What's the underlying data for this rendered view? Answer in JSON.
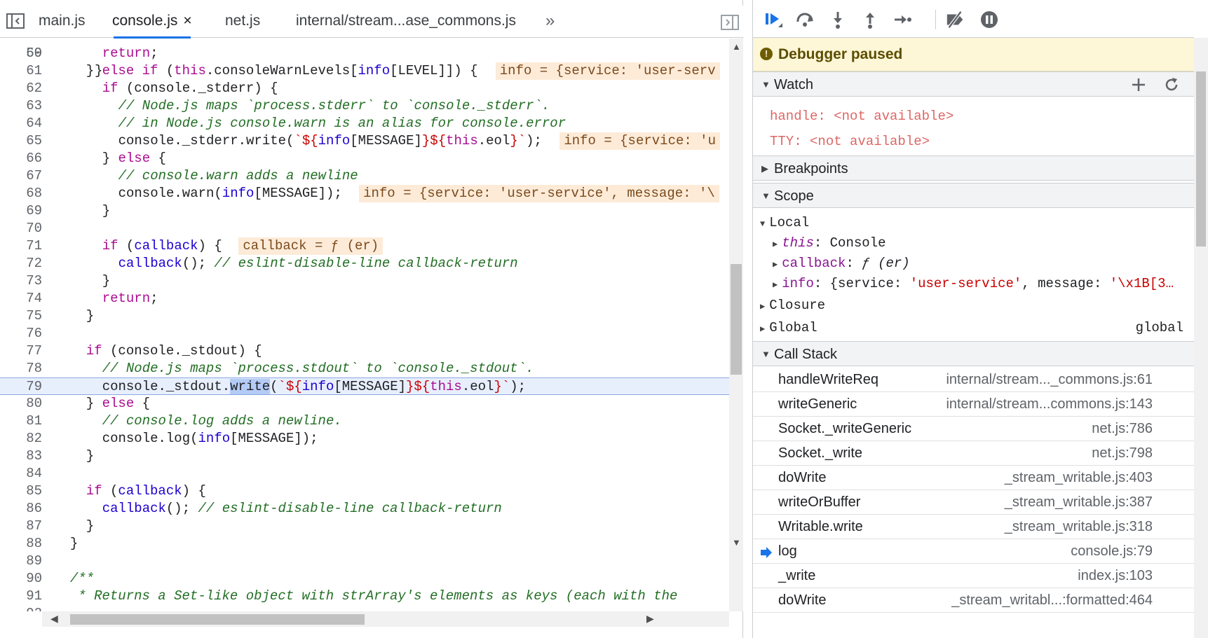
{
  "tabs": [
    {
      "label": "main.js",
      "active": false
    },
    {
      "label": "console.js",
      "active": true
    },
    {
      "label": "net.js",
      "active": false
    },
    {
      "label": "internal/stream...ase_commons.js",
      "active": false
    }
  ],
  "tab_close_glyph": "×",
  "tab_more_glyph": "»",
  "code": {
    "first_line_partial": "59",
    "current_line": "79",
    "lines": [
      {
        "n": "60",
        "indent": 6,
        "parts": [
          [
            "kw",
            "return"
          ],
          [
            "plain",
            ";"
          ]
        ]
      },
      {
        "n": "61",
        "indent": 4,
        "parts": [
          [
            "plain",
            "} "
          ],
          [
            "kw",
            "else if"
          ],
          [
            "plain",
            " ("
          ],
          [
            "kw",
            "this"
          ],
          [
            "plain",
            ".consoleWarnLevels["
          ],
          [
            "id",
            "info"
          ],
          [
            "plain",
            "[LEVEL]]) {"
          ]
        ],
        "inline": "info = {service: 'user-serv"
      },
      {
        "n": "62",
        "indent": 6,
        "parts": [
          [
            "kw",
            "if"
          ],
          [
            "plain",
            " (console._stderr) {"
          ]
        ]
      },
      {
        "n": "63",
        "indent": 8,
        "parts": [
          [
            "cm",
            "// Node.js maps `process.stderr` to `console._stderr`."
          ]
        ]
      },
      {
        "n": "64",
        "indent": 8,
        "parts": [
          [
            "cm",
            "// in Node.js console.warn is an alias for console.error"
          ]
        ]
      },
      {
        "n": "65",
        "indent": 8,
        "parts": [
          [
            "plain",
            "console._stderr.write("
          ],
          [
            "str",
            "`${"
          ],
          [
            "id",
            "info"
          ],
          [
            "plain",
            "[MESSAGE]"
          ],
          [
            "str",
            "}${"
          ],
          [
            "kw",
            "this"
          ],
          [
            "plain",
            ".eol"
          ],
          [
            "str",
            "}`"
          ],
          [
            "plain",
            ");"
          ]
        ],
        "inline": "info = {service: 'u"
      },
      {
        "n": "66",
        "indent": 6,
        "parts": [
          [
            "plain",
            "} "
          ],
          [
            "kw",
            "else"
          ],
          [
            "plain",
            " {"
          ]
        ]
      },
      {
        "n": "67",
        "indent": 8,
        "parts": [
          [
            "cm",
            "// console.warn adds a newline"
          ]
        ]
      },
      {
        "n": "68",
        "indent": 8,
        "parts": [
          [
            "plain",
            "console.warn("
          ],
          [
            "id",
            "info"
          ],
          [
            "plain",
            "[MESSAGE]);"
          ]
        ],
        "inline": "info = {service: 'user-service', message: '\\"
      },
      {
        "n": "69",
        "indent": 6,
        "parts": [
          [
            "plain",
            "}"
          ]
        ]
      },
      {
        "n": "70",
        "indent": 0,
        "parts": []
      },
      {
        "n": "71",
        "indent": 6,
        "parts": [
          [
            "kw",
            "if"
          ],
          [
            "plain",
            " ("
          ],
          [
            "id",
            "callback"
          ],
          [
            "plain",
            ") {"
          ]
        ],
        "inline": "callback = ƒ (er)"
      },
      {
        "n": "72",
        "indent": 8,
        "parts": [
          [
            "id",
            "callback"
          ],
          [
            "plain",
            "(); "
          ],
          [
            "cm",
            "// eslint-disable-line callback-return"
          ]
        ]
      },
      {
        "n": "73",
        "indent": 6,
        "parts": [
          [
            "plain",
            "}"
          ]
        ]
      },
      {
        "n": "74",
        "indent": 6,
        "parts": [
          [
            "kw",
            "return"
          ],
          [
            "plain",
            ";"
          ]
        ]
      },
      {
        "n": "75",
        "indent": 4,
        "parts": [
          [
            "plain",
            "}"
          ]
        ]
      },
      {
        "n": "76",
        "indent": 0,
        "parts": []
      },
      {
        "n": "77",
        "indent": 4,
        "parts": [
          [
            "kw",
            "if"
          ],
          [
            "plain",
            " (console._stdout) {"
          ]
        ]
      },
      {
        "n": "78",
        "indent": 6,
        "parts": [
          [
            "cm",
            "// Node.js maps `process.stdout` to `console._stdout`."
          ]
        ]
      },
      {
        "n": "79",
        "indent": 6,
        "parts": [
          [
            "plain",
            "console._stdout."
          ],
          [
            "hl",
            "write"
          ],
          [
            "plain",
            "("
          ],
          [
            "str",
            "`${"
          ],
          [
            "id",
            "info"
          ],
          [
            "plain",
            "[MESSAGE]"
          ],
          [
            "str",
            "}${"
          ],
          [
            "kw",
            "this"
          ],
          [
            "plain",
            ".eol"
          ],
          [
            "str",
            "}`"
          ],
          [
            "plain",
            ");"
          ]
        ]
      },
      {
        "n": "80",
        "indent": 4,
        "parts": [
          [
            "plain",
            "} "
          ],
          [
            "kw",
            "else"
          ],
          [
            "plain",
            " {"
          ]
        ]
      },
      {
        "n": "81",
        "indent": 6,
        "parts": [
          [
            "cm",
            "// console.log adds a newline."
          ]
        ]
      },
      {
        "n": "82",
        "indent": 6,
        "parts": [
          [
            "plain",
            "console.log("
          ],
          [
            "id",
            "info"
          ],
          [
            "plain",
            "[MESSAGE]);"
          ]
        ]
      },
      {
        "n": "83",
        "indent": 4,
        "parts": [
          [
            "plain",
            "}"
          ]
        ]
      },
      {
        "n": "84",
        "indent": 0,
        "parts": []
      },
      {
        "n": "85",
        "indent": 4,
        "parts": [
          [
            "kw",
            "if"
          ],
          [
            "plain",
            " ("
          ],
          [
            "id",
            "callback"
          ],
          [
            "plain",
            ") {"
          ]
        ]
      },
      {
        "n": "86",
        "indent": 6,
        "parts": [
          [
            "id",
            "callback"
          ],
          [
            "plain",
            "(); "
          ],
          [
            "cm",
            "// eslint-disable-line callback-return"
          ]
        ]
      },
      {
        "n": "87",
        "indent": 4,
        "parts": [
          [
            "plain",
            "}"
          ]
        ]
      },
      {
        "n": "88",
        "indent": 2,
        "parts": [
          [
            "plain",
            "}"
          ]
        ]
      },
      {
        "n": "89",
        "indent": 0,
        "parts": []
      },
      {
        "n": "90",
        "indent": 2,
        "parts": [
          [
            "cm",
            "/**"
          ]
        ]
      },
      {
        "n": "91",
        "indent": 2,
        "parts": [
          [
            "cm",
            " * Returns a Set-like object with strArray's elements as keys (each with the"
          ]
        ]
      },
      {
        "n": "92",
        "indent": 0,
        "parts": []
      }
    ]
  },
  "debugger": {
    "paused_text": "Debugger paused",
    "watch": {
      "title": "Watch",
      "items": [
        {
          "key": "handle:",
          "value": "<not available>"
        },
        {
          "key": "TTY:",
          "value": "<not available>"
        }
      ]
    },
    "breakpoints_title": "Breakpoints",
    "scope": {
      "title": "Scope",
      "local_label": "Local",
      "local_items": [
        {
          "key": "this",
          "sep": ": ",
          "value": "Console",
          "italic": true
        },
        {
          "key": "callback",
          "sep": ": ",
          "value": "ƒ (er)",
          "italic": false
        },
        {
          "key": "info",
          "sep": ": ",
          "value": "{service: ",
          "str": "'user-service'",
          "rest": ", message: ",
          "str2": "'\\x1B[3…"
        }
      ],
      "closure_label": "Closure",
      "global_label": "Global",
      "global_value": "global"
    },
    "call_stack": {
      "title": "Call Stack",
      "frames": [
        {
          "fn": "handleWriteReq",
          "loc": "internal/stream..._commons.js:61",
          "current": false
        },
        {
          "fn": "writeGeneric",
          "loc": "internal/stream...commons.js:143",
          "current": false
        },
        {
          "fn": "Socket._writeGeneric",
          "loc": "net.js:786",
          "current": false
        },
        {
          "fn": "Socket._write",
          "loc": "net.js:798",
          "current": false
        },
        {
          "fn": "doWrite",
          "loc": "_stream_writable.js:403",
          "current": false
        },
        {
          "fn": "writeOrBuffer",
          "loc": "_stream_writable.js:387",
          "current": false
        },
        {
          "fn": "Writable.write",
          "loc": "_stream_writable.js:318",
          "current": false
        },
        {
          "fn": "log",
          "loc": "console.js:79",
          "current": true
        },
        {
          "fn": "_write",
          "loc": "index.js:103",
          "current": false
        },
        {
          "fn": "doWrite",
          "loc": "_stream_writabl...:formatted:464",
          "current": false
        }
      ]
    }
  },
  "colors": {
    "accent": "#1a73e8",
    "paused_bg": "#fdf6d7",
    "inline_value_bg": "#fdebd8",
    "current_line_bg": "#e8effc"
  }
}
